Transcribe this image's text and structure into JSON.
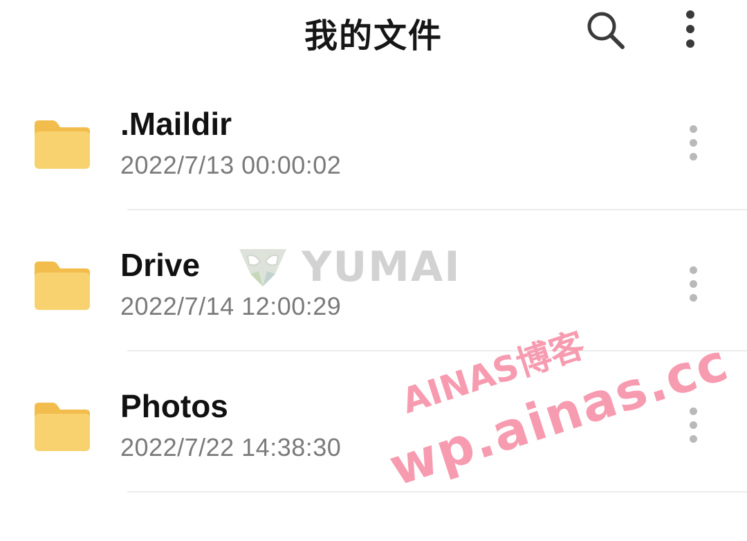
{
  "header": {
    "title": "我的文件",
    "search_icon": "search-icon",
    "more_icon": "more-vertical-icon"
  },
  "files": [
    {
      "name": ".Maildir",
      "date": "2022/7/13 00:00:02",
      "icon": "folder-icon"
    },
    {
      "name": "Drive",
      "date": "2022/7/14 12:00:29",
      "icon": "folder-icon"
    },
    {
      "name": "Photos",
      "date": "2022/7/22 14:38:30",
      "icon": "folder-icon"
    }
  ],
  "watermarks": {
    "yumai": "YUMAI",
    "ainas_line1": "AINAS博客",
    "ainas_line2": "wp.ainas.cc"
  },
  "colors": {
    "folder": "#f7d26e",
    "folder_tab": "#f2bd4d",
    "title_text": "#161616",
    "date_text": "#7a7a7a",
    "watermark_pink": "#f79bb0"
  }
}
